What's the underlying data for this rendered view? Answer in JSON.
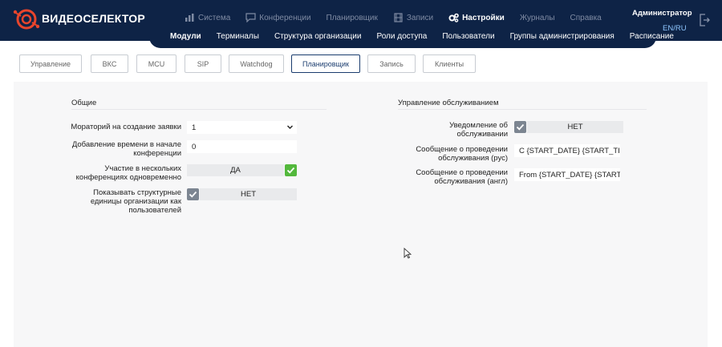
{
  "header": {
    "brand": "ВИДЕОСЕЛЕКТОР",
    "nav": [
      {
        "label": "Система",
        "icon": "chart-icon",
        "active": false
      },
      {
        "label": "Конференции",
        "icon": "chat-icon",
        "active": false
      },
      {
        "label": "Планировщик",
        "icon": "",
        "active": false
      },
      {
        "label": "Записи",
        "icon": "film-icon",
        "active": false
      },
      {
        "label": "Настройки",
        "icon": "gears-icon",
        "active": true
      },
      {
        "label": "Журналы",
        "icon": "",
        "active": false
      },
      {
        "label": "Справка",
        "icon": "",
        "active": false
      }
    ],
    "user": "Администратор",
    "lang": "EN/RU"
  },
  "subnav": [
    "Модули",
    "Терминалы",
    "Структура организации",
    "Роли доступа",
    "Пользователи",
    "Группы администрирования",
    "Расписание"
  ],
  "tabs": [
    "Управление",
    "ВКС",
    "MCU",
    "SIP",
    "Watchdog",
    "Планировщик",
    "Запись",
    "Клиенты"
  ],
  "active_tab": "Планировщик",
  "general": {
    "title": "Общие",
    "moratorium_label": "Мораторий на создание заявки",
    "moratorium_value": "1",
    "add_time_label": "Добавление времени в начале конференции",
    "add_time_value": "0",
    "multi_label": "Участие в нескольких конференциях одновременно",
    "multi_value": "ДА",
    "show_units_label": "Показывать структурные единицы организации как пользователей",
    "show_units_value": "НЕТ"
  },
  "maintenance": {
    "title": "Управление обслуживанием",
    "notify_label": "Уведомление об обслуживании",
    "notify_value": "НЕТ",
    "msg_ru_label": "Сообщение о проведении обслуживания (рус)",
    "msg_ru_value": "С {START_DATE} {START_TIME}",
    "msg_en_label": "Сообщение о проведении обслуживания (англ)",
    "msg_en_value": "From {START_DATE} {START_TIME}"
  },
  "colors": {
    "header_bg": "#0e2346",
    "accent": "#1a3c6e",
    "check_green": "#53b83c",
    "check_grey": "#7c8591"
  }
}
